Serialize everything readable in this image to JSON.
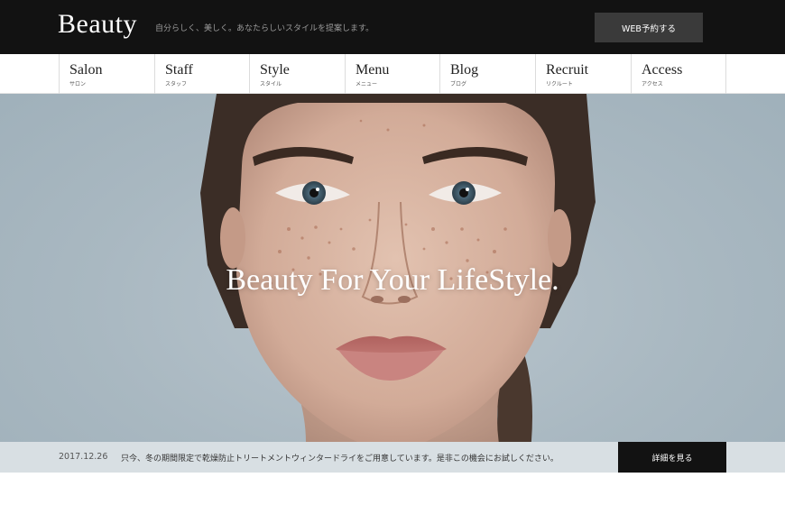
{
  "header": {
    "logo": "Beauty",
    "tagline": "自分らしく、美しく。あなたらしいスタイルを提案します。",
    "reserve_button": "WEB予約する"
  },
  "nav": {
    "items": [
      {
        "label": "Salon",
        "sub": "サロン"
      },
      {
        "label": "Staff",
        "sub": "スタッフ"
      },
      {
        "label": "Style",
        "sub": "スタイル"
      },
      {
        "label": "Menu",
        "sub": "メニュー"
      },
      {
        "label": "Blog",
        "sub": "ブログ"
      },
      {
        "label": "Recruit",
        "sub": "リクルート"
      },
      {
        "label": "Access",
        "sub": "アクセス"
      }
    ]
  },
  "hero": {
    "heading": "Beauty For Your LifeStyle."
  },
  "notice": {
    "date": "2017.12.26",
    "text": "只今、冬の期間限定で乾燥防止トリートメントウィンタードライをご用意しています。是非この機会にお試しください。",
    "button": "詳細を見る"
  },
  "colors": {
    "header_bg": "#121212",
    "reserve_button_bg": "#3a3a3a",
    "notice_bg": "#d6dde2",
    "notice_button_bg": "#121212"
  }
}
